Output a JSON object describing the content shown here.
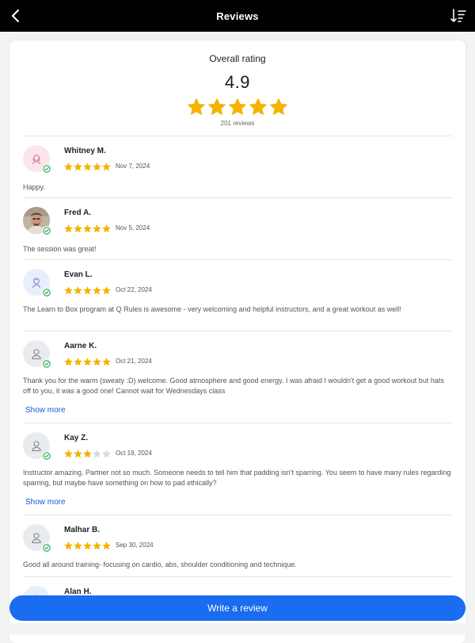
{
  "header": {
    "title": "Reviews",
    "back_icon": "back-arrow-icon",
    "sort_icon": "sort-icon"
  },
  "summary": {
    "label": "Overall rating",
    "score": "4.9",
    "stars": 5,
    "count": "201 reviews"
  },
  "colors": {
    "star": "#f5b301",
    "star_empty": "#d7d9de",
    "accent": "#1a6cf0",
    "link": "#1a56d9",
    "verified": "#27a845"
  },
  "reviews": [
    {
      "name": "Whitney M.",
      "date": "Nov 7, 2024",
      "rating": 5,
      "text": "Happy.",
      "show_more": "",
      "avatar": "female-avatar-icon",
      "avatar_bg": "#fbe6ee",
      "avatar_fg": "#d9809f"
    },
    {
      "name": "Fred A.",
      "date": "Nov 5, 2024",
      "rating": 5,
      "text": "The session was great!",
      "show_more": "",
      "avatar": "photo-avatar",
      "avatar_bg": "#c9bfb0",
      "avatar_fg": "#6b5c4c"
    },
    {
      "name": "Evan L.",
      "date": "Oct 22, 2024",
      "rating": 5,
      "text": "The Learn to Box program at Q Rules is awesome - very welcoming and helpful instructors, and a great workout as well!",
      "show_more": "",
      "avatar": "male-avatar-icon",
      "avatar_bg": "#e8eefc",
      "avatar_fg": "#7f95cf"
    },
    {
      "name": "Aarne K.",
      "date": "Oct 21, 2024",
      "rating": 5,
      "text": "Thank you for the warm (sweaty :D) welcome. Good atmosphere and good energy. I was afraid I wouldn't get a good workout but hats off to you, it was a good one! Cannot wait for Wednesdays class",
      "show_more": "Show more",
      "avatar": "user-avatar-icon",
      "avatar_bg": "#e9ebee",
      "avatar_fg": "#8a9099"
    },
    {
      "name": "Kay Z.",
      "date": "Oct 19, 2024",
      "rating": 3,
      "text": "Instructor amazing. Partner not so much. Someone needs to tell him that padding isn't sparring. You seem to have many rules regarding sparring, but maybe have something on how to pad ethically?",
      "show_more": "Show more",
      "avatar": "user-avatar-icon",
      "avatar_bg": "#e9ebee",
      "avatar_fg": "#8a9099"
    },
    {
      "name": "Malhar B.",
      "date": "Sep 30, 2024",
      "rating": 5,
      "text": "Good all around training- focusing on cardio, abs, shoulder conditioning and technique.",
      "show_more": "",
      "avatar": "user-avatar-icon",
      "avatar_bg": "#e9ebee",
      "avatar_fg": "#8a9099"
    },
    {
      "name": "Alan H.",
      "date": "",
      "rating": 0,
      "text": "",
      "show_more": "",
      "avatar": "male-avatar-icon",
      "avatar_bg": "#e8eefc",
      "avatar_fg": "#7f95cf"
    }
  ],
  "footer": {
    "write_label": "Write a review"
  }
}
